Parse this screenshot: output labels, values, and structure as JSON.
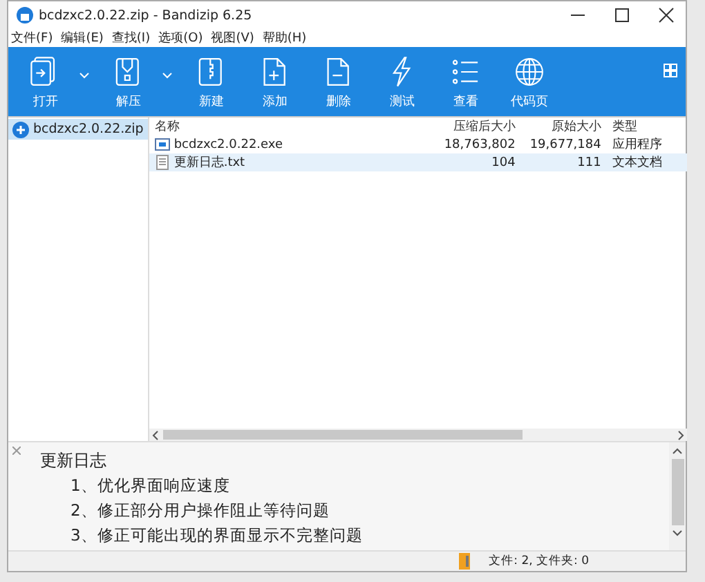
{
  "window": {
    "title": "bcdzxc2.0.22.zip - Bandizip 6.25"
  },
  "menu": [
    "文件(F)",
    "编辑(E)",
    "查找(I)",
    "选项(O)",
    "视图(V)",
    "帮助(H)"
  ],
  "toolbar": [
    {
      "label": "打开",
      "kind": "open",
      "dropdown": true
    },
    {
      "label": "解压",
      "kind": "extract",
      "dropdown": true
    },
    {
      "label": "新建",
      "kind": "new",
      "dropdown": false
    },
    {
      "label": "添加",
      "kind": "add",
      "dropdown": false
    },
    {
      "label": "删除",
      "kind": "delete",
      "dropdown": false
    },
    {
      "label": "测试",
      "kind": "test",
      "dropdown": false
    },
    {
      "label": "查看",
      "kind": "view",
      "dropdown": false
    },
    {
      "label": "代码页",
      "kind": "codepage",
      "dropdown": false
    }
  ],
  "tree": [
    {
      "label": "bcdzxc2.0.22.zip",
      "selected": true
    }
  ],
  "table": {
    "columns": [
      "名称",
      "压缩后大小",
      "原始大小",
      "类型"
    ],
    "rows": [
      {
        "name": "bcdzxc2.0.22.exe",
        "kind": "exe",
        "compressed": "18,763,802",
        "original": "19,677,184",
        "type": "应用程序",
        "selected": false
      },
      {
        "name": "更新日志.txt",
        "kind": "txt",
        "compressed": "104",
        "original": "111",
        "type": "文本文档",
        "selected": true
      }
    ]
  },
  "preview": {
    "title": "更新日志",
    "lines": [
      "1、优化界面响应速度",
      "2、修正部分用户操作阻止等待问题",
      "3、修正可能出现的界面显示不完整问题"
    ]
  },
  "status_bar": {
    "text": "文件: 2, 文件夹: 0"
  }
}
